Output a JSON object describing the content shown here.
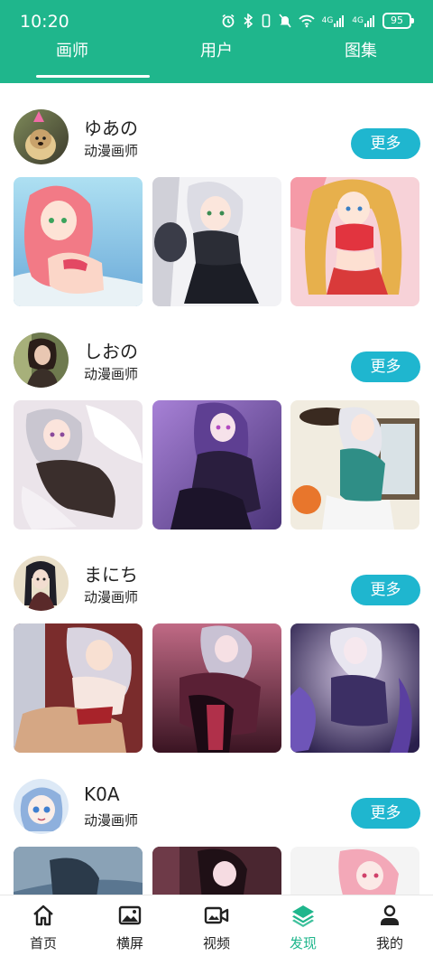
{
  "status_bar": {
    "time": "10:20",
    "battery": "95",
    "signal_1": "4G",
    "signal_2": "4G"
  },
  "tabs": [
    {
      "label": "画师",
      "active": true
    },
    {
      "label": "用户",
      "active": false
    },
    {
      "label": "图集",
      "active": false
    }
  ],
  "artists": [
    {
      "name": "ゆあの",
      "role": "动漫画师",
      "more_label": "更多",
      "avatar_colors": [
        "#c9a26b",
        "#e3c88f"
      ],
      "thumb_colors": [
        [
          "#9cd4ec",
          "#f27a86"
        ],
        [
          "#e8e8ec",
          "#2b2d36"
        ],
        [
          "#f7d2d8",
          "#e7b04c"
        ]
      ]
    },
    {
      "name": "しおの",
      "role": "动漫画师",
      "more_label": "更多",
      "avatar_colors": [
        "#6e7a4e",
        "#caa890"
      ],
      "thumb_colors": [
        [
          "#ebe4ea",
          "#3a2e2c"
        ],
        [
          "#8a63b8",
          "#2a1e3e"
        ],
        [
          "#f1ece0",
          "#2f8e86"
        ]
      ]
    },
    {
      "name": "まにち",
      "role": "动漫画师",
      "more_label": "更多",
      "avatar_colors": [
        "#e9dfc9",
        "#1f1f28"
      ],
      "thumb_colors": [
        [
          "#7a2c2c",
          "#d5a784"
        ],
        [
          "#5a2035",
          "#c06a85"
        ],
        [
          "#3c2f64",
          "#cfc3de"
        ]
      ]
    },
    {
      "name": "K0A",
      "role": "动漫画师",
      "more_label": "更多",
      "avatar_colors": [
        "#dde9f6",
        "#8eb0dd"
      ],
      "thumb_colors": [
        [
          "#5a7690",
          "#2b3a4a"
        ],
        [
          "#4a2630",
          "#e0a0b4"
        ],
        [
          "#f4f4f4",
          "#f3a8b8"
        ]
      ]
    }
  ],
  "bottom_nav": [
    {
      "label": "首页",
      "icon": "home-icon",
      "active": false
    },
    {
      "label": "横屏",
      "icon": "image-icon",
      "active": false
    },
    {
      "label": "视频",
      "icon": "video-icon",
      "active": false
    },
    {
      "label": "发现",
      "icon": "layers-icon",
      "active": true
    },
    {
      "label": "我的",
      "icon": "user-icon",
      "active": false
    }
  ],
  "colors": {
    "header": "#1fb68c",
    "accent_button": "#1fb6cf",
    "active_nav": "#1fb68c"
  }
}
